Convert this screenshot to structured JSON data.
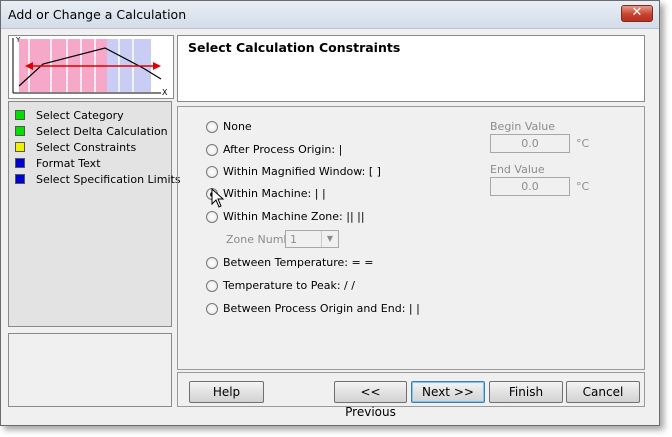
{
  "window": {
    "title": "Add or Change a Calculation",
    "close_symbol": "✕"
  },
  "thumbnail": {
    "y_label": "Y",
    "x_label": "X"
  },
  "steps": [
    {
      "label": "Select Category",
      "color": "#00e000"
    },
    {
      "label": "Select Delta Calculation",
      "color": "#00e000"
    },
    {
      "label": "Select Constraints",
      "color": "#f0f000"
    },
    {
      "label": "Format Text",
      "color": "#0000d0"
    },
    {
      "label": "Select Specification Limits",
      "color": "#0000d0"
    }
  ],
  "panel": {
    "title": "Select Calculation Constraints"
  },
  "options": [
    {
      "label": "None",
      "selected": false
    },
    {
      "label": "After Process Origin: |",
      "selected": false
    },
    {
      "label": "Within Magnified Window: [ ]",
      "selected": false
    },
    {
      "label": "Within Machine: | |",
      "selected": true
    },
    {
      "label": "Within Machine Zone: || ||",
      "selected": false
    },
    {
      "label": "Between Temperature: = =",
      "selected": false
    },
    {
      "label": "Temperature to Peak: / /",
      "selected": false
    },
    {
      "label": "Between Process Origin and End: | |",
      "selected": false
    }
  ],
  "zone": {
    "label": "Zone Number",
    "value": "1"
  },
  "begin": {
    "label": "Begin Value",
    "value": "0.0",
    "unit": "°C"
  },
  "end": {
    "label": "End Value",
    "value": "0.0",
    "unit": "°C"
  },
  "buttons": {
    "help": "Help",
    "previous": "<< Previous",
    "next": "Next >>",
    "finish": "Finish",
    "cancel": "Cancel"
  }
}
